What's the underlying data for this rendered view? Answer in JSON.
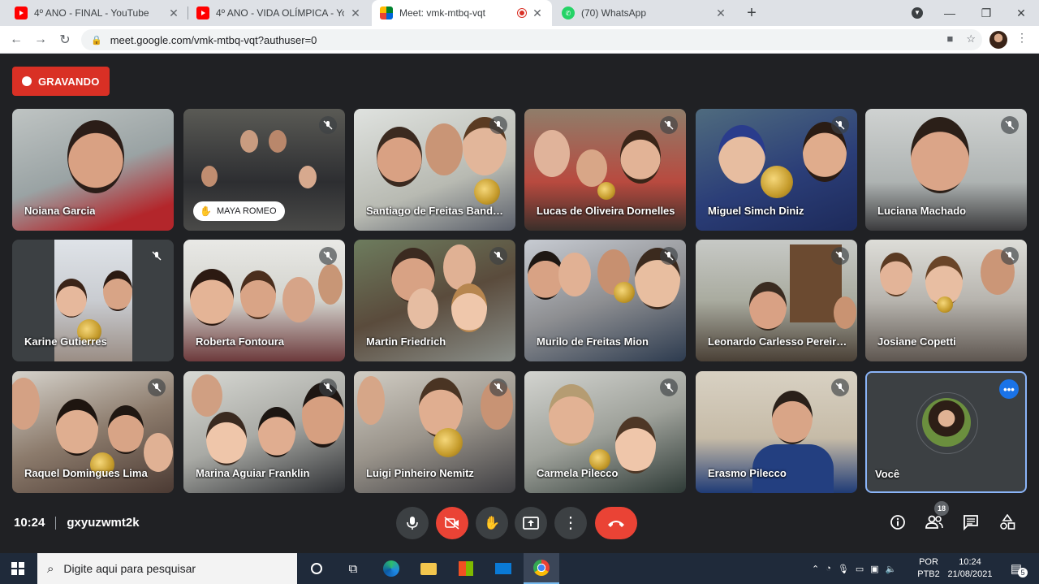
{
  "browser": {
    "tabs": [
      {
        "title": "4º ANO - FINAL - YouTube",
        "icon": "youtube-icon"
      },
      {
        "title": "4º ANO - VIDA OLÍMPICA - YouT…",
        "icon": "youtube-icon"
      },
      {
        "title": "Meet: vmk-mtbq-vqt",
        "icon": "meet-icon",
        "recording": true
      },
      {
        "title": "(70) WhatsApp",
        "icon": "whatsapp-icon"
      }
    ],
    "url": "meet.google.com/vmk-mtbq-vqt?authuser=0"
  },
  "meet": {
    "recording_label": "GRAVANDO",
    "hand_raised_name": "MAYA ROMEO",
    "participants": [
      "Noiana Garcia",
      "",
      "Santiago de Freitas Band…",
      "Lucas de Oliveira Dornelles",
      "Miguel Simch Diniz",
      "Luciana Machado",
      "Karine Gutierres",
      "Roberta Fontoura",
      "Martin Friedrich",
      "Murilo de Freitas Mion",
      "Leonardo Carlesso Pereir…",
      "Josiane Copetti",
      "Raquel Domingues Lima",
      "Marina Aguiar Franklin",
      "Luigi Pinheiro Nemitz",
      "Carmela Pilecco",
      "Erasmo Pilecco",
      "Você"
    ],
    "time": "10:24",
    "meeting_code": "gxyuzwmt2k",
    "participant_count": "18"
  },
  "taskbar": {
    "search_placeholder": "Digite aqui para pesquisar",
    "lang_top": "POR",
    "lang_bottom": "PTB2",
    "clock_time": "10:24",
    "clock_date": "21/08/2021",
    "notification_count": "5"
  }
}
